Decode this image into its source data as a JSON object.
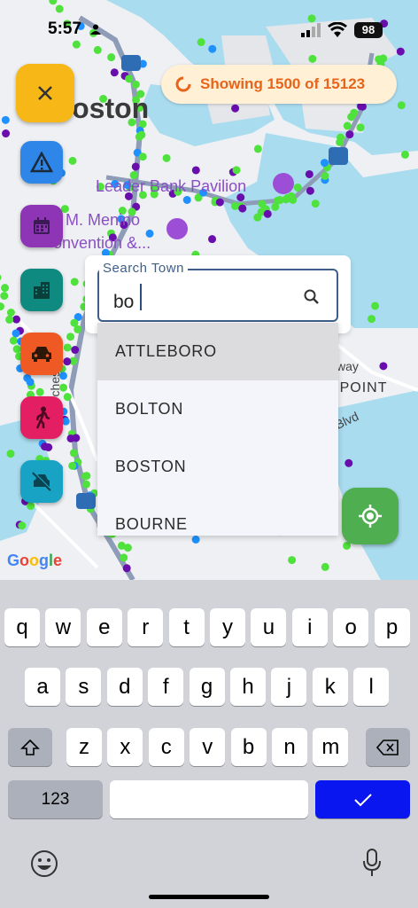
{
  "status_bar": {
    "time": "5:57",
    "battery": "98"
  },
  "map": {
    "labels": {
      "boston": "Boston",
      "pavilion": "Leader Bank Pavilion",
      "menino": "s M. Menino",
      "convention": "onvention &...",
      "dorchester": "Dorchester",
      "point": "TY POINT",
      "way": "way",
      "blvd": "Blvd",
      "google": "Google"
    },
    "showing": {
      "text": "Showing 1500 of 15123",
      "color": "#e8641a"
    }
  },
  "fabs": {
    "close": "close-icon",
    "hazard": "warning-icon",
    "calendar": "calendar-icon",
    "building": "building-icon",
    "car": "car-icon",
    "pedestrian": "pedestrian-icon",
    "nodrive": "no-drive-icon",
    "locate": "my-location-icon"
  },
  "search": {
    "label": "Search Town",
    "value": "bo",
    "options": [
      "ATTLEBORO",
      "BOLTON",
      "BOSTON",
      "BOURNE"
    ],
    "highlighted": "ATTLEBORO"
  },
  "keyboard": {
    "row1": [
      "q",
      "w",
      "e",
      "r",
      "t",
      "y",
      "u",
      "i",
      "o",
      "p"
    ],
    "row2": [
      "a",
      "s",
      "d",
      "f",
      "g",
      "h",
      "j",
      "k",
      "l"
    ],
    "row3": [
      "z",
      "x",
      "c",
      "v",
      "b",
      "n",
      "m"
    ],
    "numbers_label": "123",
    "done_icon": "checkmark-icon",
    "done_color": "#0a16f0"
  }
}
